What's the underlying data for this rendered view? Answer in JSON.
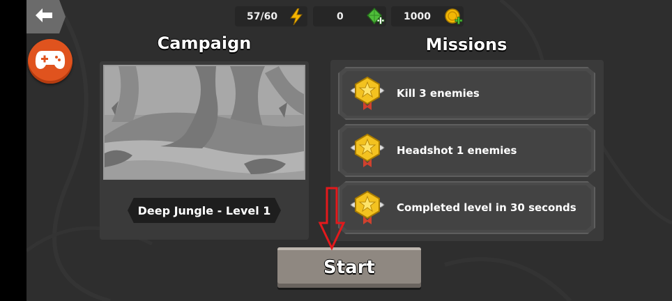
{
  "top_bar": {
    "energy": {
      "value": "57/60",
      "icon": "lightning-icon",
      "color": "#f5b400"
    },
    "gems": {
      "value": "0",
      "icon": "green-gem-add-icon",
      "color": "#4fbe3a"
    },
    "coins": {
      "value": "1000",
      "icon": "gold-coin-add-icon",
      "color": "#f2b705"
    }
  },
  "nav": {
    "back_icon": "back-arrow-icon",
    "gamepad_icon": "gamepad-icon",
    "gamepad_color": "#e0531e"
  },
  "campaign": {
    "title": "Campaign",
    "level_label": "Deep Jungle - Level 1"
  },
  "missions": {
    "title": "Missions",
    "items": [
      {
        "label": "Kill 3 enemies",
        "icon": "gold-medal-icon"
      },
      {
        "label": "Headshot 1 enemies",
        "icon": "gold-medal-icon"
      },
      {
        "label": "Completed level in 30 seconds",
        "icon": "gold-medal-icon"
      }
    ]
  },
  "start_button": {
    "label": "Start"
  },
  "annotation": {
    "icon": "red-down-arrow-icon",
    "color": "#e3191c"
  }
}
